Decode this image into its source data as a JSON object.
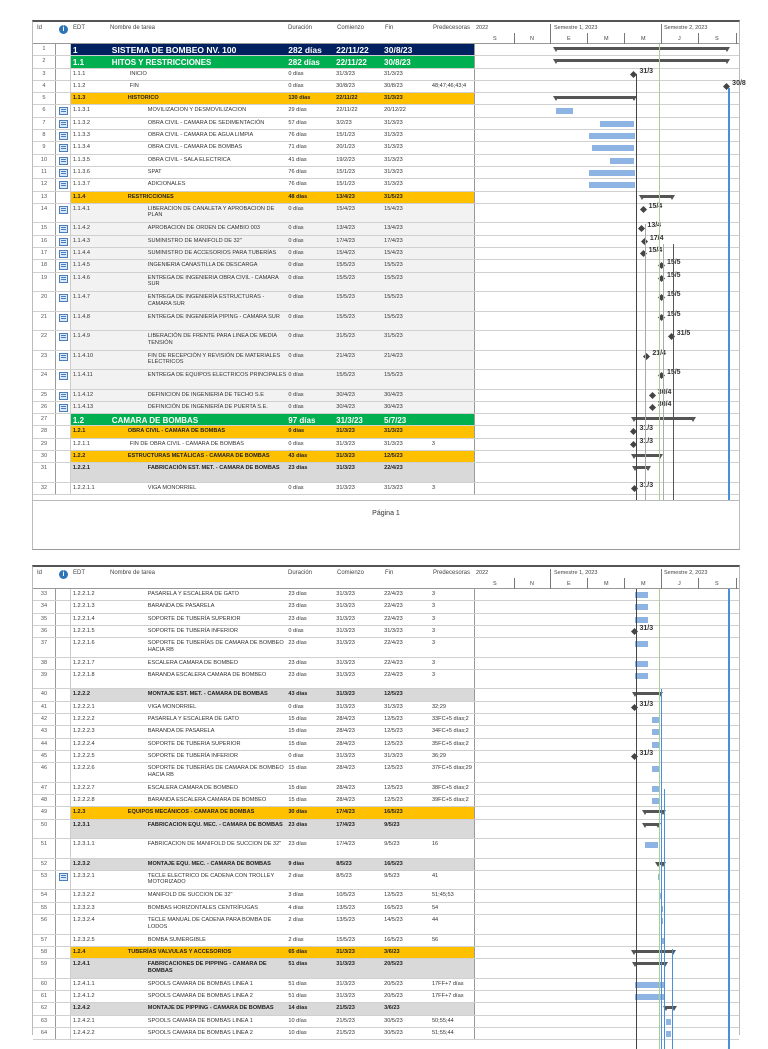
{
  "header": {
    "id": "Id",
    "edt": "EDT",
    "name": "Nombre de tarea",
    "dur": "Duración",
    "start": "Comienzo",
    "end": "Fin",
    "pred": "Predecesoras",
    "info_icon": "i"
  },
  "timeline": {
    "year": "2022",
    "sem1": "Semestre 1, 2023",
    "sem2": "Semestre 2, 2023",
    "months": [
      "S",
      "N",
      "E",
      "M",
      "M",
      "J",
      "S"
    ]
  },
  "colors": {
    "navy": "#002060",
    "green": "#00b050",
    "orange": "#ffc000",
    "gray": "#d9d9d9",
    "bar": "#8db4e2",
    "status": "#a9d18e"
  },
  "pages": [
    {
      "footer": "Página 1",
      "rows": [
        {
          "id": "1",
          "edt": "1",
          "name": "SISTEMA DE BOMBEO NV. 100",
          "dur": "282 días",
          "start": "22/11/22",
          "end": "30/8/23",
          "pred": "",
          "lv": 0
        },
        {
          "id": "2",
          "edt": "1.1",
          "name": "HITOS Y RESTRICCIONES",
          "dur": "282 días",
          "start": "22/11/22",
          "end": "30/8/23",
          "pred": "",
          "lv": 1
        },
        {
          "id": "3",
          "edt": "1.1.1",
          "name": "INICIO",
          "dur": "0 días",
          "start": "31/3/23",
          "end": "31/3/23",
          "pred": "",
          "lv": 4,
          "ms": "31/3"
        },
        {
          "id": "4",
          "edt": "1.1.2",
          "name": "FIN",
          "dur": "0 días",
          "start": "30/8/23",
          "end": "30/8/23",
          "pred": "48;47;46;43;4",
          "lv": 4,
          "ms": "30/8"
        },
        {
          "id": "5",
          "edt": "1.1.3",
          "name": "HISTORICO",
          "dur": "130 días",
          "start": "22/11/22",
          "end": "31/3/23",
          "pred": "",
          "lv": 2
        },
        {
          "id": "6",
          "edt": "1.1.3.1",
          "name": "MOVILIZACION Y DESMOVILIZACION",
          "dur": "29 días",
          "start": "22/11/22",
          "end": "20/12/22",
          "pred": "",
          "lv": 5,
          "icon": true
        },
        {
          "id": "7",
          "edt": "1.1.3.2",
          "name": "OBRA CIVIL - CAMARA DE SEDIMENTACIÓN",
          "dur": "57 días",
          "start": "3/2/23",
          "end": "31/3/23",
          "pred": "",
          "lv": 5,
          "icon": true
        },
        {
          "id": "8",
          "edt": "1.1.3.3",
          "name": "OBRA CIVIL - CAMARA DE AGUA LIMPIA",
          "dur": "76 días",
          "start": "15/1/23",
          "end": "31/3/23",
          "pred": "",
          "lv": 5,
          "icon": true
        },
        {
          "id": "9",
          "edt": "1.1.3.4",
          "name": "OBRA CIVIL - CAMARA DE BOMBAS",
          "dur": "71 días",
          "start": "20/1/23",
          "end": "31/3/23",
          "pred": "",
          "lv": 5,
          "icon": true
        },
        {
          "id": "10",
          "edt": "1.1.3.5",
          "name": "OBRA CIVIL - SALA ELECTRICA",
          "dur": "41 días",
          "start": "19/2/23",
          "end": "31/3/23",
          "pred": "",
          "lv": 5,
          "icon": true
        },
        {
          "id": "11",
          "edt": "1.1.3.6",
          "name": "SPAT",
          "dur": "76 días",
          "start": "15/1/23",
          "end": "31/3/23",
          "pred": "",
          "lv": 5,
          "icon": true
        },
        {
          "id": "12",
          "edt": "1.1.3.7",
          "name": "ADICIONALES",
          "dur": "76 días",
          "start": "15/1/23",
          "end": "31/3/23",
          "pred": "",
          "lv": 5,
          "icon": true
        },
        {
          "id": "13",
          "edt": "1.1.4",
          "name": "RESTRICCIONES",
          "dur": "48 días",
          "start": "13/4/23",
          "end": "31/5/23",
          "pred": "",
          "lv": 2
        },
        {
          "id": "14",
          "edt": "1.1.4.1",
          "name": "LIBERACION DE CANALETA Y APROBACION DE PLAN",
          "dur": "0 días",
          "start": "15/4/23",
          "end": "15/4/23",
          "pred": "",
          "lv": 6,
          "icon": true,
          "ms": "15/4",
          "tall": true
        },
        {
          "id": "15",
          "edt": "1.1.4.2",
          "name": "APROBACION DE ORDEN DE CAMBIO 003",
          "dur": "0 días",
          "start": "13/4/23",
          "end": "13/4/23",
          "pred": "",
          "lv": 6,
          "icon": true,
          "ms": "13/4"
        },
        {
          "id": "16",
          "edt": "1.1.4.3",
          "name": "SUMINISTRO DE MANIFOLD DE 32\"",
          "dur": "0 días",
          "start": "17/4/23",
          "end": "17/4/23",
          "pred": "",
          "lv": 6,
          "icon": true,
          "ms": "17/4"
        },
        {
          "id": "17",
          "edt": "1.1.4.4",
          "name": "SUMINISTRO DE ACCESORIOS PARA TUBERÍAS",
          "dur": "0 días",
          "start": "15/4/23",
          "end": "15/4/23",
          "pred": "",
          "lv": 6,
          "icon": true,
          "ms": "15/4"
        },
        {
          "id": "18",
          "edt": "1.1.4.5",
          "name": "INGENIERIA CANASTILLA DE DESCARGA",
          "dur": "0 días",
          "start": "15/5/23",
          "end": "15/5/23",
          "pred": "",
          "lv": 6,
          "icon": true,
          "ms": "15/5"
        },
        {
          "id": "19",
          "edt": "1.1.4.6",
          "name": "ENTREGA DE INGENIERIA OBRA CIVIL - CAMARA SUR",
          "dur": "0 días",
          "start": "15/5/23",
          "end": "15/5/23",
          "pred": "",
          "lv": 6,
          "icon": true,
          "ms": "15/5",
          "tall": true
        },
        {
          "id": "20",
          "edt": "1.1.4.7",
          "name": "ENTREGA DE INGENIERÍA ESTRUCTURAS - CAMARA SUR",
          "dur": "0 días",
          "start": "15/5/23",
          "end": "15/5/23",
          "pred": "",
          "lv": 6,
          "icon": true,
          "ms": "15/5",
          "tall": true
        },
        {
          "id": "21",
          "edt": "1.1.4.8",
          "name": "ENTREGA DE INGENIERÍA PIPING - CAMARA SUR",
          "dur": "0 días",
          "start": "15/5/23",
          "end": "15/5/23",
          "pred": "",
          "lv": 6,
          "icon": true,
          "ms": "15/5",
          "tall": true
        },
        {
          "id": "22",
          "edt": "1.1.4.9",
          "name": "LIBERACIÓN DE FRENTE PARA LINEA DE MEDIA TENSIÓN",
          "dur": "0 días",
          "start": "31/5/23",
          "end": "31/5/23",
          "pred": "",
          "lv": 6,
          "icon": true,
          "ms": "31/5",
          "tall": true
        },
        {
          "id": "23",
          "edt": "1.1.4.10",
          "name": "FIN DE RECEPCIÓN Y REVISIÓN DE MATERIALES ELÉCTRICOS",
          "dur": "0 días",
          "start": "21/4/23",
          "end": "21/4/23",
          "pred": "",
          "lv": 6,
          "icon": true,
          "ms": "21/4",
          "tall": true
        },
        {
          "id": "24",
          "edt": "1.1.4.11",
          "name": "ENTREGA DE EQUIPOS ELECTRICOS PRINCIPALES",
          "dur": "0 días",
          "start": "15/5/23",
          "end": "15/5/23",
          "pred": "",
          "lv": 6,
          "icon": true,
          "ms": "15/5",
          "tall": true
        },
        {
          "id": "25",
          "edt": "1.1.4.12",
          "name": "DEFINICION DE INGENIERIA DE TECHO S.E",
          "dur": "0 días",
          "start": "30/4/23",
          "end": "30/4/23",
          "pred": "",
          "lv": 6,
          "icon": true,
          "ms": "30/4"
        },
        {
          "id": "26",
          "edt": "1.1.4.13",
          "name": "DEFINICIÓN DE INGENIERÍA DE PUERTA S.E.",
          "dur": "0 días",
          "start": "30/4/23",
          "end": "30/4/23",
          "pred": "",
          "lv": 6,
          "icon": true,
          "ms": "30/4"
        },
        {
          "id": "27",
          "edt": "1.2",
          "name": "CAMARA DE BOMBAS",
          "dur": "97 días",
          "start": "31/3/23",
          "end": "5/7/23",
          "pred": "",
          "lv": 1
        },
        {
          "id": "28",
          "edt": "1.2.1",
          "name": "OBRA CIVIL - CAMARA DE BOMBAS",
          "dur": "0 días",
          "start": "31/3/23",
          "end": "31/3/23",
          "pred": "",
          "lv": 2,
          "ms": "31/3"
        },
        {
          "id": "29",
          "edt": "1.2.1.1",
          "name": "FIN DE OBRA CIVIL - CAMARA DE BOMBAS",
          "dur": "0 días",
          "start": "31/3/23",
          "end": "31/3/23",
          "pred": "3",
          "lv": 4,
          "ms": "31/3"
        },
        {
          "id": "30",
          "edt": "1.2.2",
          "name": "ESTRUCTURAS METÁLICAS - CAMARA DE BOMBAS",
          "dur": "43 días",
          "start": "31/3/23",
          "end": "12/5/23",
          "pred": "",
          "lv": 2
        },
        {
          "id": "31",
          "edt": "1.2.2.1",
          "name": "FABRICACIÓN EST. MET. - CAMARA DE BOMBAS",
          "dur": "23 días",
          "start": "31/3/23",
          "end": "22/4/23",
          "pred": "",
          "lv": 3,
          "tall": true
        },
        {
          "id": "32",
          "edt": "1.2.2.1.1",
          "name": "VIGA MONORRIEL",
          "dur": "0 días",
          "start": "31/3/23",
          "end": "31/3/23",
          "pred": "3",
          "lv": 5,
          "ms": "31/3"
        }
      ]
    },
    {
      "rows": [
        {
          "id": "33",
          "edt": "1.2.2.1.2",
          "name": "PASARELA Y ESCALERA DE GATO",
          "dur": "23 días",
          "start": "31/3/23",
          "end": "22/4/23",
          "pred": "3",
          "lv": 5
        },
        {
          "id": "34",
          "edt": "1.2.2.1.3",
          "name": "BARANDA DE PASARELA",
          "dur": "23 días",
          "start": "31/3/23",
          "end": "22/4/23",
          "pred": "3",
          "lv": 5
        },
        {
          "id": "35",
          "edt": "1.2.2.1.4",
          "name": "SOPORTE DE TUBERÍA SUPERIOR",
          "dur": "23 días",
          "start": "31/3/23",
          "end": "22/4/23",
          "pred": "3",
          "lv": 5
        },
        {
          "id": "36",
          "edt": "1.2.2.1.5",
          "name": "SOPORTE DE TUBERÍA INFERIOR",
          "dur": "0 días",
          "start": "31/3/23",
          "end": "31/3/23",
          "pred": "3",
          "lv": 5,
          "ms": "31/3"
        },
        {
          "id": "37",
          "edt": "1.2.2.1.6",
          "name": "SOPORTE DE TUBERÍAS DE CAMARA DE BOMBEO HACIA RB",
          "dur": "23 días",
          "start": "31/3/23",
          "end": "22/4/23",
          "pred": "3",
          "lv": 5,
          "tall": true
        },
        {
          "id": "38",
          "edt": "1.2.2.1.7",
          "name": "ESCALERA CAMARA DE BOMBEO",
          "dur": "23 días",
          "start": "31/3/23",
          "end": "22/4/23",
          "pred": "3",
          "lv": 5
        },
        {
          "id": "39",
          "edt": "1.2.2.1.8",
          "name": "BARANDA ESCALERA CAMARA DE BOMBEO",
          "dur": "23 días",
          "start": "31/3/23",
          "end": "22/4/23",
          "pred": "3",
          "lv": 5,
          "tall": true
        },
        {
          "id": "40",
          "edt": "1.2.2.2",
          "name": "MONTAJE EST. MET. - CAMARA DE BOMBAS",
          "dur": "43 días",
          "start": "31/3/23",
          "end": "12/5/23",
          "pred": "",
          "lv": 3
        },
        {
          "id": "41",
          "edt": "1.2.2.2.1",
          "name": "VIGA MONORRIEL",
          "dur": "0 días",
          "start": "31/3/23",
          "end": "31/3/23",
          "pred": "32;29",
          "lv": 5,
          "ms": "31/3"
        },
        {
          "id": "42",
          "edt": "1.2.2.2.2",
          "name": "PASARELA Y ESCALERA DE GATO",
          "dur": "15 días",
          "start": "28/4/23",
          "end": "12/5/23",
          "pred": "33FC+5 días;2",
          "lv": 5
        },
        {
          "id": "43",
          "edt": "1.2.2.2.3",
          "name": "BARANDA DE PASARELA",
          "dur": "15 días",
          "start": "28/4/23",
          "end": "12/5/23",
          "pred": "34FC+5 días;2",
          "lv": 5
        },
        {
          "id": "44",
          "edt": "1.2.2.2.4",
          "name": "SOPORTE DE TUBERIA SUPERIOR",
          "dur": "15 días",
          "start": "28/4/23",
          "end": "12/5/23",
          "pred": "35FC+5 días;2",
          "lv": 5
        },
        {
          "id": "45",
          "edt": "1.2.2.2.5",
          "name": "SOPORTE DE TUBERÍA INFERIOR",
          "dur": "0 días",
          "start": "31/3/23",
          "end": "31/3/23",
          "pred": "36;29",
          "lv": 5,
          "ms": "31/3"
        },
        {
          "id": "46",
          "edt": "1.2.2.2.6",
          "name": "SOPORTE DE TUBERÍAS DE CAMARA DE BOMBEO HACIA RB",
          "dur": "15 días",
          "start": "28/4/23",
          "end": "12/5/23",
          "pred": "37FC+5 días;29",
          "lv": 5,
          "tall": true
        },
        {
          "id": "47",
          "edt": "1.2.2.2.7",
          "name": "ESCALERA CAMARA DE BOMBEO",
          "dur": "15 días",
          "start": "28/4/23",
          "end": "12/5/23",
          "pred": "38FC+5 días;2",
          "lv": 5
        },
        {
          "id": "48",
          "edt": "1.2.2.2.8",
          "name": "BARANDA ESCALERA CAMARA DE BOMBEO",
          "dur": "15 días",
          "start": "28/4/23",
          "end": "12/5/23",
          "pred": "39FC+5 días;2",
          "lv": 5
        },
        {
          "id": "49",
          "edt": "1.2.3",
          "name": "EQUIPOS MECÁNICOS - CAMARA DE BOMBAS",
          "dur": "30 días",
          "start": "17/4/23",
          "end": "16/5/23",
          "pred": "",
          "lv": 2
        },
        {
          "id": "50",
          "edt": "1.2.3.1",
          "name": "FABRICACION EQU. MEC. - CAMARA DE BOMBAS",
          "dur": "23 días",
          "start": "17/4/23",
          "end": "9/5/23",
          "pred": "",
          "lv": 3,
          "tall": true
        },
        {
          "id": "51",
          "edt": "1.2.3.1.1",
          "name": "FABRICACION DE MANIFOLD DE SUCCION DE 32\"",
          "dur": "23 días",
          "start": "17/4/23",
          "end": "9/5/23",
          "pred": "16",
          "lv": 5,
          "tall": true
        },
        {
          "id": "52",
          "edt": "1.2.3.2",
          "name": "MONTAJE EQU. MEC. - CAMARA DE BOMBAS",
          "dur": "9 días",
          "start": "8/5/23",
          "end": "16/5/23",
          "pred": "",
          "lv": 3
        },
        {
          "id": "53",
          "edt": "1.2.3.2.1",
          "name": "TECLE ELECTRICO DE CADENA CON TROLLEY MOTORIZADO",
          "dur": "2 días",
          "start": "8/5/23",
          "end": "9/5/23",
          "pred": "41",
          "lv": 5,
          "icon": true,
          "tall": true
        },
        {
          "id": "54",
          "edt": "1.2.3.2.2",
          "name": "MANIFOLD DE SUCCION DE 32\"",
          "dur": "3 días",
          "start": "10/5/23",
          "end": "12/5/23",
          "pred": "51;45;53",
          "lv": 5
        },
        {
          "id": "55",
          "edt": "1.2.3.2.3",
          "name": "BOMBAS HORIZONTALES CENTRÍFUGAS",
          "dur": "4 días",
          "start": "13/5/23",
          "end": "16/5/23",
          "pred": "54",
          "lv": 5
        },
        {
          "id": "56",
          "edt": "1.2.3.2.4",
          "name": "TECLE MANUAL DE CADENA PARA BOMBA DE LODOS",
          "dur": "2 días",
          "start": "13/5/23",
          "end": "14/5/23",
          "pred": "44",
          "lv": 5,
          "tall": true
        },
        {
          "id": "57",
          "edt": "1.2.3.2.5",
          "name": "BOMBA SUMERGIBLE",
          "dur": "2 días",
          "start": "15/5/23",
          "end": "16/5/23",
          "pred": "56",
          "lv": 5
        },
        {
          "id": "58",
          "edt": "1.2.4",
          "name": "TUBERÍAS VALVULAS Y ACCESORIOS",
          "dur": "65 días",
          "start": "31/3/23",
          "end": "3/6/23",
          "pred": "",
          "lv": 2
        },
        {
          "id": "59",
          "edt": "1.2.4.1",
          "name": "FABRICACIONES DE PIPPING - CAMARA DE BOMBAS",
          "dur": "51 días",
          "start": "31/3/23",
          "end": "20/5/23",
          "pred": "",
          "lv": 3,
          "tall": true
        },
        {
          "id": "60",
          "edt": "1.2.4.1.1",
          "name": "SPOOLS CAMARA DE BOMBAS LINEA 1",
          "dur": "51 días",
          "start": "31/3/23",
          "end": "20/5/23",
          "pred": "17FF+7 días",
          "lv": 5
        },
        {
          "id": "61",
          "edt": "1.2.4.1.2",
          "name": "SPOOLS CAMARA DE BOMBAS LINEA 2",
          "dur": "51 días",
          "start": "31/3/23",
          "end": "20/5/23",
          "pred": "17FF+7 días",
          "lv": 5
        },
        {
          "id": "62",
          "edt": "1.2.4.2",
          "name": "MONTAJE DE PIPPING - CAMARA DE BOMBAS",
          "dur": "14 días",
          "start": "21/5/23",
          "end": "3/6/23",
          "pred": "",
          "lv": 3
        },
        {
          "id": "63",
          "edt": "1.2.4.2.1",
          "name": "SPOOLS CAMARA DE BOMBAS LINEA 1",
          "dur": "10 días",
          "start": "21/5/23",
          "end": "30/5/23",
          "pred": "50;55;44",
          "lv": 5
        },
        {
          "id": "64",
          "edt": "1.2.4.2.2",
          "name": "SPOOLS CAMARA DE BOMBAS LINEA 2",
          "dur": "10 días",
          "start": "21/5/23",
          "end": "30/5/23",
          "pred": "51;55;44",
          "lv": 5
        }
      ]
    }
  ]
}
